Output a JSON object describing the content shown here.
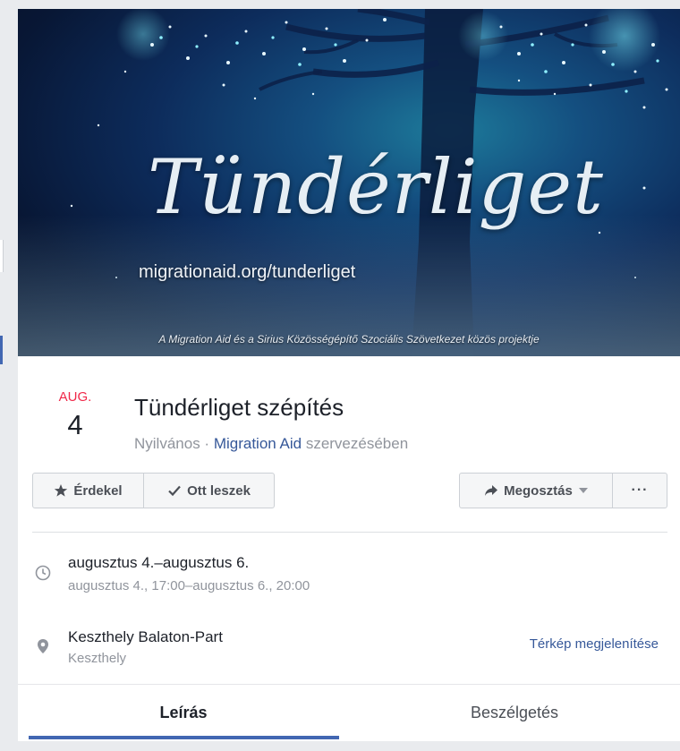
{
  "cover": {
    "title": "Tündérliget",
    "url": "migrationaid.org/tunderliget",
    "caption": "A Migration Aid és a Sirius Közösségépítő Szociális Szövetkezet közös projektje"
  },
  "event": {
    "month": "AUG.",
    "day": "4",
    "title": "Tündérliget szépítés",
    "privacy": "Nyilvános",
    "separator": " · ",
    "organizer": "Migration Aid",
    "organizer_suffix": " szervezésében"
  },
  "actions": {
    "interested": "Érdekel",
    "going": "Ott leszek",
    "share": "Megosztás",
    "more": "···"
  },
  "details": {
    "date_main": "augusztus 4.–augusztus 6.",
    "date_sub": "augusztus 4., 17:00–augusztus 6., 20:00",
    "place_main": "Keszthely Balaton-Part",
    "place_sub": "Keszthely",
    "map_link": "Térkép megjelenítése"
  },
  "tabs": {
    "about": "Leírás",
    "discussion": "Beszélgetés"
  },
  "icons": {
    "star": "star-icon",
    "check": "check-icon",
    "share": "share-arrow-icon",
    "clock": "clock-icon",
    "pin": "location-pin-icon"
  },
  "colors": {
    "accent": "#4267b2",
    "link": "#365899",
    "month": "#f02849",
    "muted": "#90949c"
  }
}
